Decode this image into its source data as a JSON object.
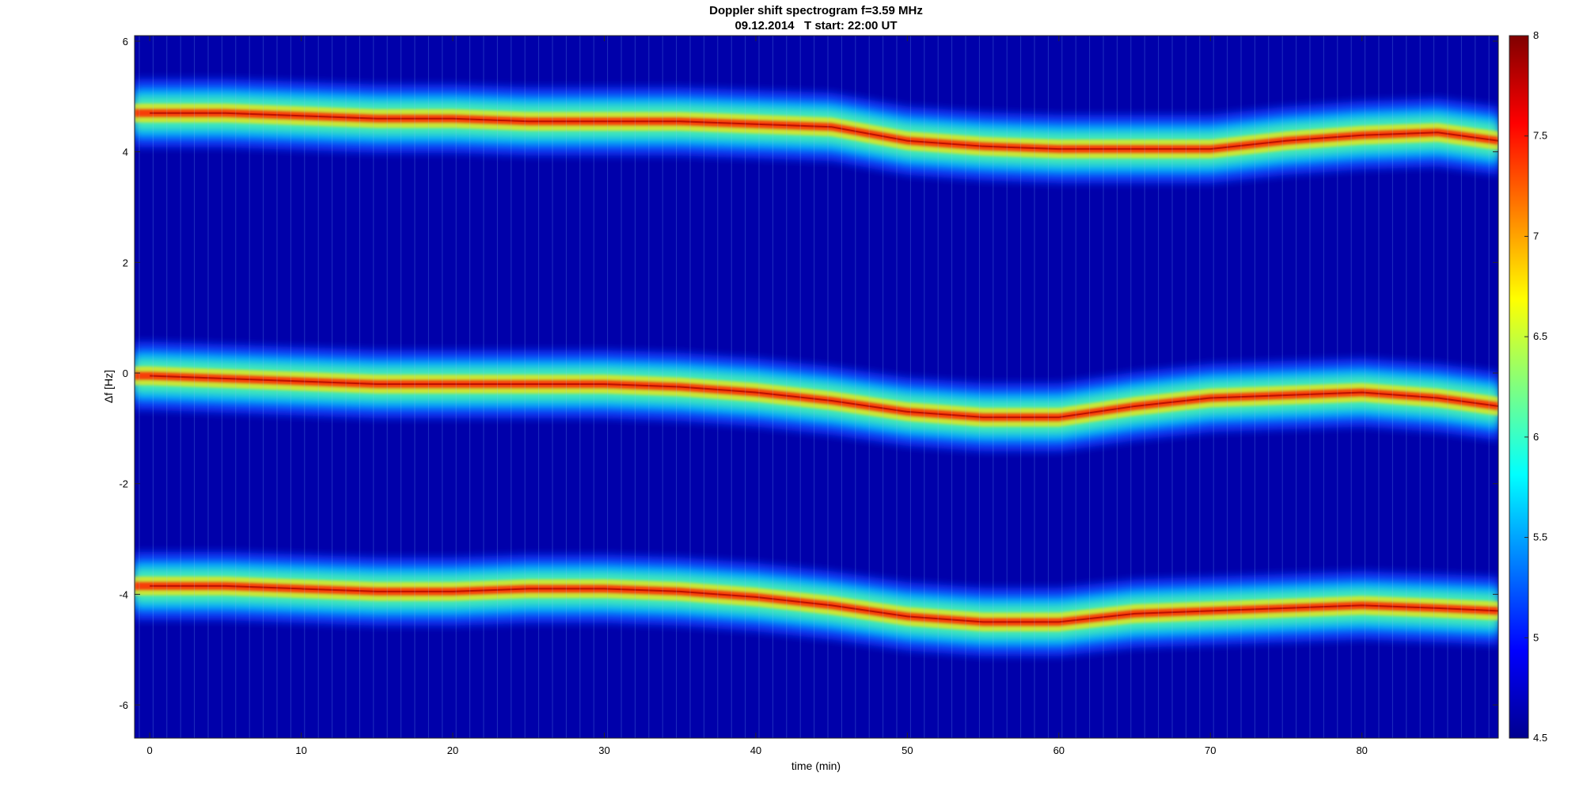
{
  "chart_data": {
    "type": "heatmap",
    "title": "Doppler shift spectrogram f=3.59 MHz",
    "subtitle": "09.12.2014   T start: 22:00 UT",
    "xlabel": "time (min)",
    "ylabel": "Δf [Hz]",
    "xlim": [
      -1,
      89
    ],
    "ylim": [
      -6.6,
      6.1
    ],
    "xticks": [
      0,
      10,
      20,
      30,
      40,
      50,
      60,
      70,
      80
    ],
    "yticks": [
      -6,
      -4,
      -2,
      0,
      2,
      4,
      6
    ],
    "colorbar": {
      "colormap": "jet",
      "clim": [
        4.5,
        8
      ],
      "ticks": [
        4.5,
        5,
        5.5,
        6,
        6.5,
        7,
        7.5,
        8
      ]
    },
    "series": [
      {
        "x": [
          0,
          5,
          10,
          15,
          20,
          25,
          30,
          35,
          40,
          45,
          50,
          55,
          60,
          65,
          70,
          75,
          80,
          85,
          89
        ],
        "y": [
          4.7,
          4.7,
          4.65,
          4.6,
          4.6,
          4.55,
          4.55,
          4.55,
          4.5,
          4.45,
          4.2,
          4.1,
          4.05,
          4.05,
          4.05,
          4.2,
          4.3,
          4.35,
          4.2
        ]
      },
      {
        "x": [
          0,
          5,
          10,
          15,
          20,
          25,
          30,
          35,
          40,
          45,
          50,
          55,
          60,
          65,
          70,
          75,
          80,
          85,
          89
        ],
        "y": [
          -0.05,
          -0.1,
          -0.15,
          -0.2,
          -0.2,
          -0.2,
          -0.2,
          -0.25,
          -0.35,
          -0.5,
          -0.7,
          -0.8,
          -0.8,
          -0.6,
          -0.45,
          -0.4,
          -0.35,
          -0.45,
          -0.6
        ]
      },
      {
        "x": [
          0,
          5,
          10,
          15,
          20,
          25,
          30,
          35,
          40,
          45,
          50,
          55,
          60,
          65,
          70,
          75,
          80,
          85,
          89
        ],
        "y": [
          -3.85,
          -3.85,
          -3.9,
          -3.95,
          -3.95,
          -3.9,
          -3.9,
          -3.95,
          -4.05,
          -4.2,
          -4.4,
          -4.5,
          -4.5,
          -4.35,
          -4.3,
          -4.25,
          -4.2,
          -4.25,
          -4.3
        ]
      }
    ]
  }
}
